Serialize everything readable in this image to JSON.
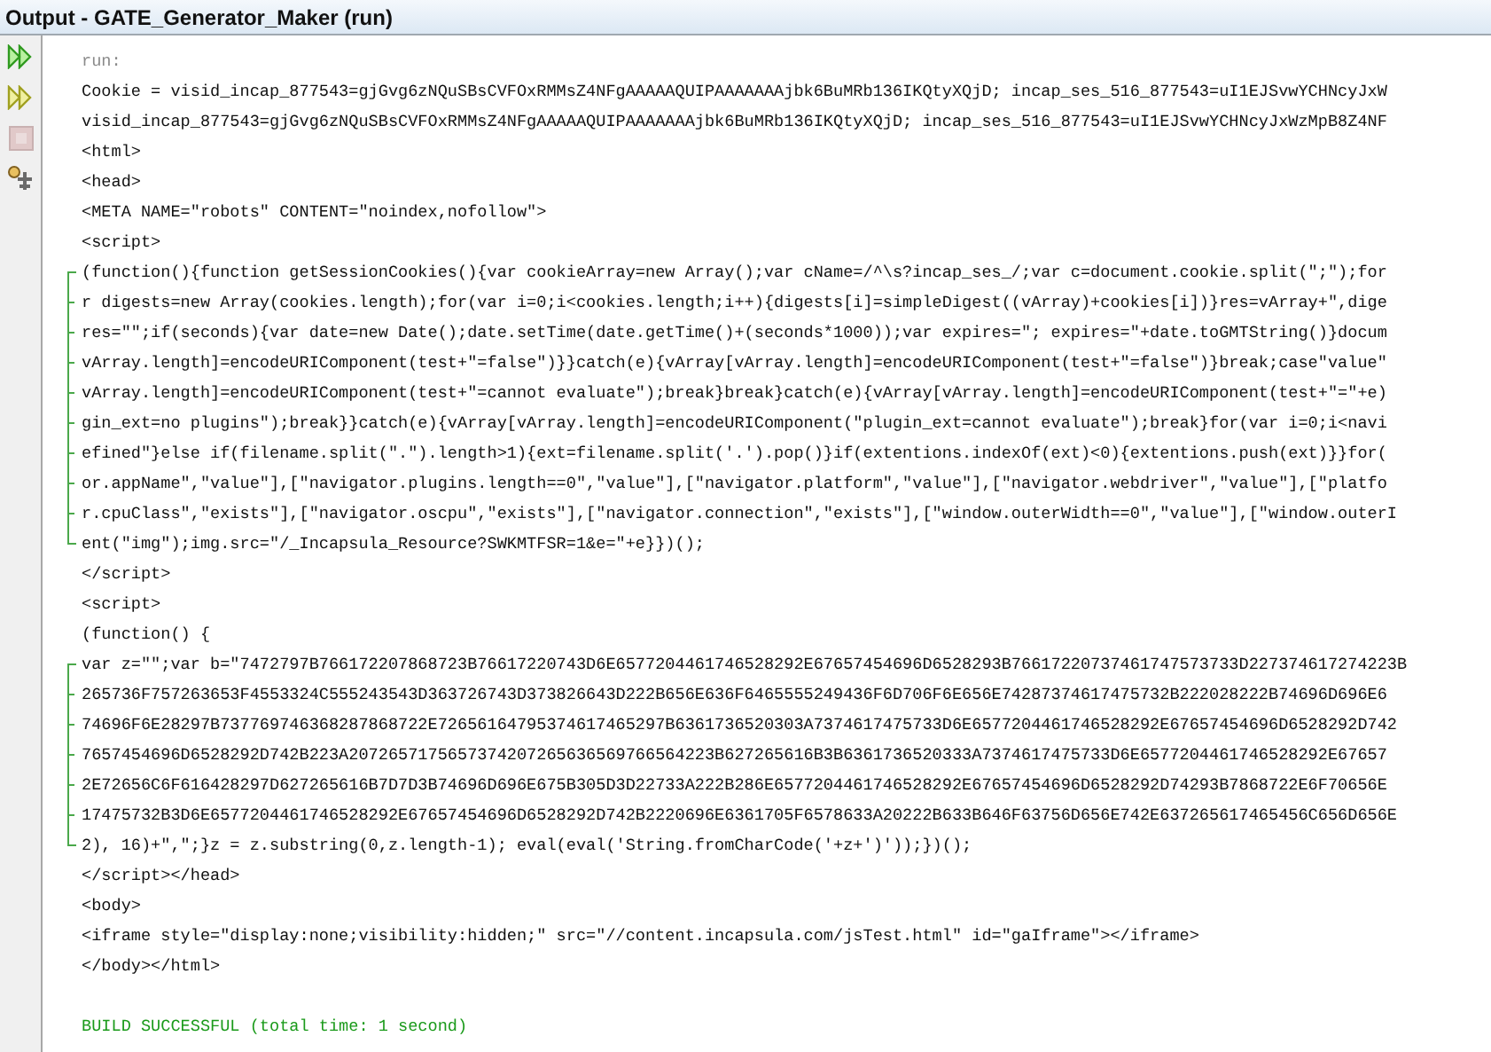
{
  "window": {
    "title": "Output - GATE_Generator_Maker (run)"
  },
  "toolbar": [
    {
      "kind": "rerun",
      "disabled": false
    },
    {
      "kind": "rerun-params",
      "disabled": false
    },
    {
      "kind": "stop",
      "disabled": true
    },
    {
      "kind": "settings",
      "disabled": false
    }
  ],
  "lines": [
    {
      "kind": "info",
      "text": "run:"
    },
    {
      "kind": "output",
      "text": "Cookie = visid_incap_877543=gjGvg6zNQuSBsCVFOxRMMsZ4NFgAAAAAQUIPAAAAAAAjbk6BuMRb136IKQtyXQjD; incap_ses_516_877543=uI1EJSvwYCHNcyJxW"
    },
    {
      "kind": "output",
      "text": "visid_incap_877543=gjGvg6zNQuSBsCVFOxRMMsZ4NFgAAAAAQUIPAAAAAAAjbk6BuMRb136IKQtyXQjD; incap_ses_516_877543=uI1EJSvwYCHNcyJxWzMpB8Z4NF"
    },
    {
      "kind": "output",
      "text": "<html>"
    },
    {
      "kind": "output",
      "text": "<head>"
    },
    {
      "kind": "output",
      "text": "<META NAME=\"robots\" CONTENT=\"noindex,nofollow\">"
    },
    {
      "kind": "output",
      "text": "<script>"
    },
    {
      "kind": "block",
      "children": [
        {
          "kind": "output",
          "text": "(function(){function getSessionCookies(){var cookieArray=new Array();var cName=/^\\s?incap_ses_/;var c=document.cookie.split(\";\");for"
        },
        {
          "kind": "output",
          "text": "r digests=new Array(cookies.length);for(var i=0;i<cookies.length;i++){digests[i]=simpleDigest((vArray)+cookies[i])}res=vArray+\",dige"
        },
        {
          "kind": "output",
          "text": "res=\"\";if(seconds){var date=new Date();date.setTime(date.getTime()+(seconds*1000));var expires=\"; expires=\"+date.toGMTString()}docum"
        },
        {
          "kind": "output",
          "text": "vArray.length]=encodeURIComponent(test+\"=false\")}}catch(e){vArray[vArray.length]=encodeURIComponent(test+\"=false\")}break;case\"value\""
        },
        {
          "kind": "output",
          "text": "vArray.length]=encodeURIComponent(test+\"=cannot evaluate\");break}break}catch(e){vArray[vArray.length]=encodeURIComponent(test+\"=\"+e)"
        },
        {
          "kind": "output",
          "text": "gin_ext=no plugins\");break}}catch(e){vArray[vArray.length]=encodeURIComponent(\"plugin_ext=cannot evaluate\");break}for(var i=0;i<navi"
        },
        {
          "kind": "output",
          "text": "efined\"}else if(filename.split(\".\").length>1){ext=filename.split('.').pop()}if(extentions.indexOf(ext)<0){extentions.push(ext)}}for("
        },
        {
          "kind": "output",
          "text": "or.appName\",\"value\"],[\"navigator.plugins.length==0\",\"value\"],[\"navigator.platform\",\"value\"],[\"navigator.webdriver\",\"value\"],[\"platfo"
        },
        {
          "kind": "output",
          "text": "r.cpuClass\",\"exists\"],[\"navigator.oscpu\",\"exists\"],[\"navigator.connection\",\"exists\"],[\"window.outerWidth==0\",\"value\"],[\"window.outerI"
        },
        {
          "kind": "output",
          "text": "ent(\"img\");img.src=\"/_Incapsula_Resource?SWKMTFSR=1&e=\"+e}})();"
        }
      ]
    },
    {
      "kind": "output",
      "text": "</script>"
    },
    {
      "kind": "output",
      "text": "<script>"
    },
    {
      "kind": "output",
      "text": "(function() {"
    },
    {
      "kind": "block",
      "children": [
        {
          "kind": "output",
          "text": "var z=\"\";var b=\"7472797B766172207868723B76617220743D6E6577204461746528292E67657454696D6528293B76617220737461747573733D227374617274223B"
        },
        {
          "kind": "output",
          "text": "265736F757263653F4553324C555243543D363726743D373826643D222B656E636F6465555249436F6D706F6E656E74287374617475732B222028222B74696D696E6"
        },
        {
          "kind": "output",
          "text": "74696F6E28297B737769746368287868722E72656164795374617465297B6361736520303A7374617475733D6E6577204461746528292E67657454696D6528292D742"
        },
        {
          "kind": "output",
          "text": "7657454696D6528292D742B223A2072657175657374207265636569766564223B627265616B3B6361736520333A7374617475733D6E6577204461746528292E67657"
        },
        {
          "kind": "output",
          "text": "2E72656C6F616428297D627265616B7D7D3B74696D696E675B305D3D22733A222B286E6577204461746528292E67657454696D6528292D74293B7868722E6F70656E"
        },
        {
          "kind": "output",
          "text": "17475732B3D6E6577204461746528292E67657454696D6528292D742B2220696E6361705F6578633A20222B633B646F63756D656E742E637265617465456C656D656E"
        },
        {
          "kind": "output",
          "text": "2), 16)+\",\";}z = z.substring(0,z.length-1); eval(eval('String.fromCharCode('+z+')'));})();"
        }
      ]
    },
    {
      "kind": "output",
      "text": "</script></head>"
    },
    {
      "kind": "output",
      "text": "<body>"
    },
    {
      "kind": "output",
      "text": "<iframe style=\"display:none;visibility:hidden;\" src=\"//content.incapsula.com/jsTest.html\" id=\"gaIframe\"></iframe>"
    },
    {
      "kind": "output",
      "text": "</body></html>"
    },
    {
      "kind": "blank"
    },
    {
      "kind": "success",
      "text": "BUILD SUCCESSFUL (total time: 1 second)"
    }
  ]
}
